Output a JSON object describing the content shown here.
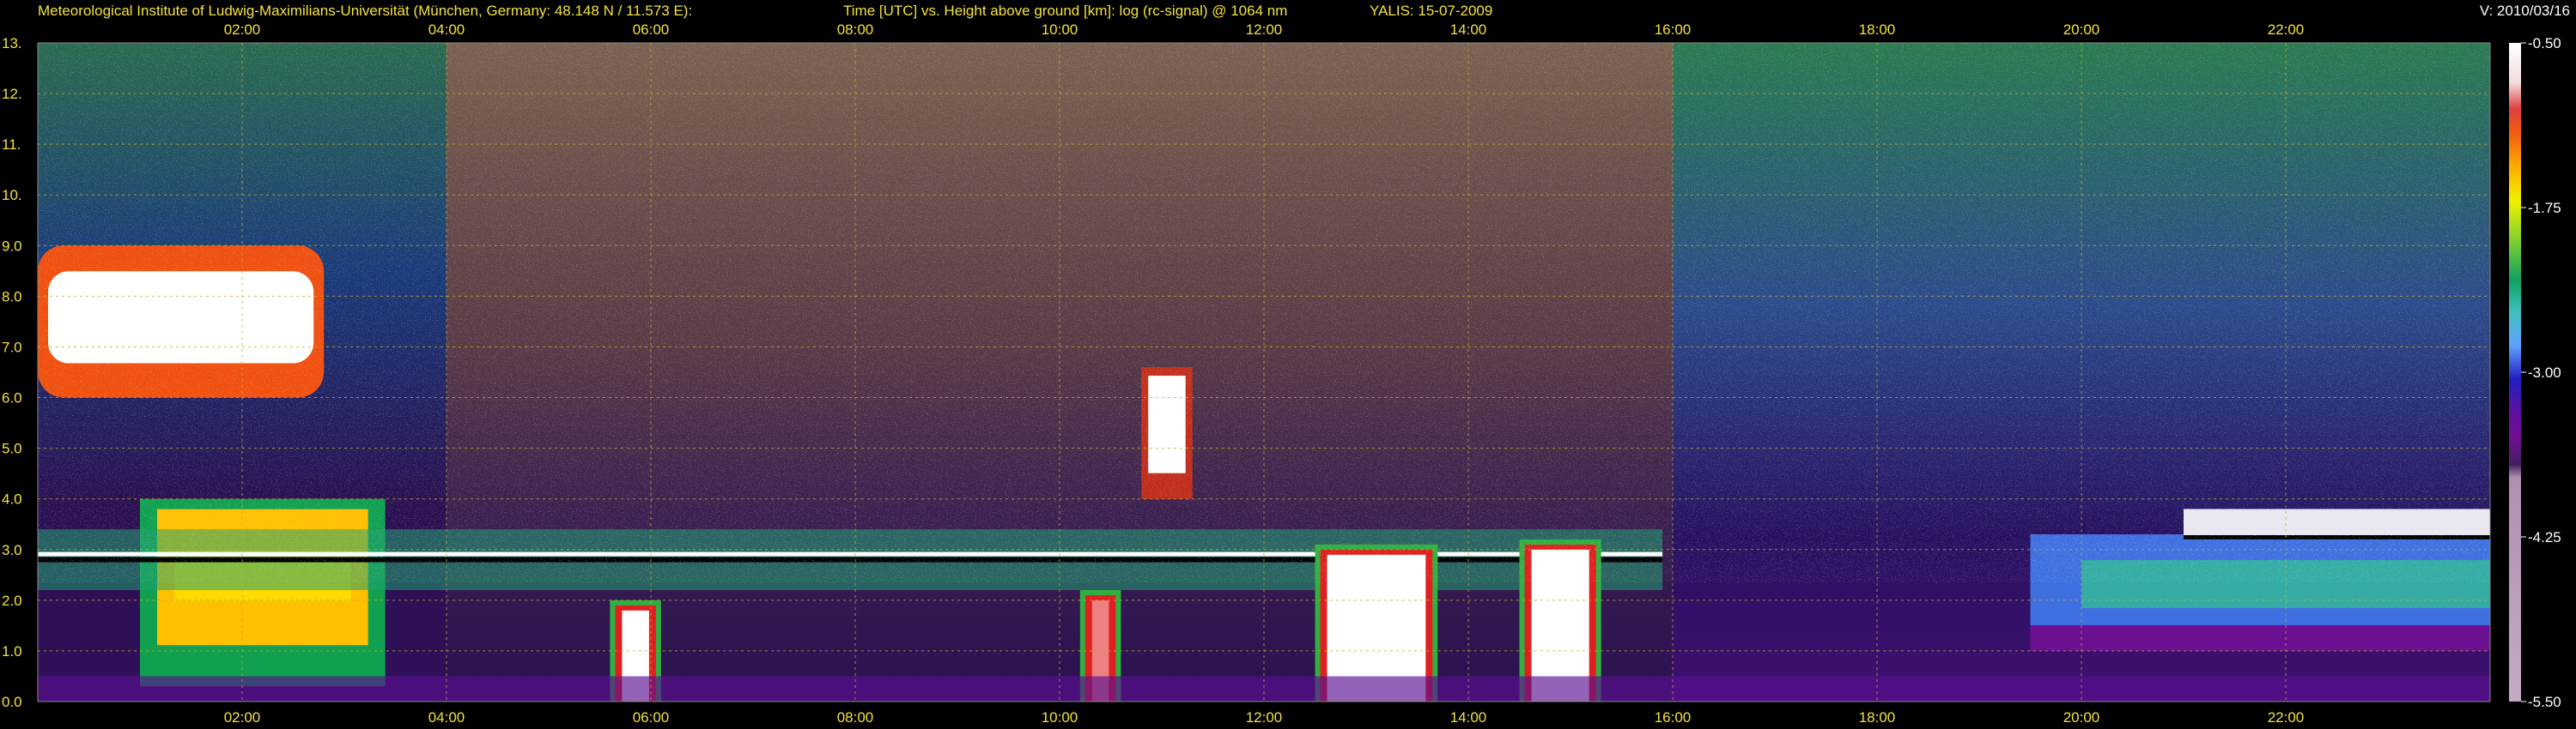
{
  "header": {
    "institute": "Meteorological Institute of Ludwig-Maximilians-Universität (München, Germany: 48.148 N / 11.573 E):",
    "description": "Time [UTC] vs. Height above ground [km]: log (rc-signal) @ 1064 nm",
    "instrument_date": "YALIS: 15-07-2009",
    "version": "V: 2010/03/16"
  },
  "colors": {
    "background": "#000000",
    "header_text": "#f4e23a",
    "tick_text": "#f4e23a",
    "gridline": "#bfae2a"
  },
  "chart_data": {
    "type": "heatmap",
    "title": "Time [UTC] vs. Height above ground [km]: log (rc-signal) @ 1064 nm",
    "x_unit": "hours UTC",
    "xlim": [
      0,
      24
    ],
    "x_ticks": [
      2,
      4,
      6,
      8,
      10,
      12,
      14,
      16,
      18,
      20,
      22
    ],
    "x_tick_labels": [
      "02:00",
      "04:00",
      "06:00",
      "08:00",
      "10:00",
      "12:00",
      "14:00",
      "16:00",
      "18:00",
      "20:00",
      "22:00"
    ],
    "ylim": [
      0,
      13
    ],
    "y_ticks": [
      0,
      1,
      2,
      3,
      4,
      5,
      6,
      7,
      8,
      9,
      10,
      11,
      12,
      13
    ],
    "y_tick_labels": [
      "0.0",
      "1.0",
      "2.0",
      "3.0",
      "4.0",
      "5.0",
      "6.0",
      "7.0",
      "8.0",
      "9.0",
      "10.",
      "11.",
      "12.",
      "13."
    ],
    "grid": true,
    "colorbar": {
      "range": [
        -5.5,
        -0.5
      ],
      "ticks": [
        -0.5,
        -1.75,
        -3.0,
        -4.25,
        -5.5
      ],
      "tick_labels": [
        "-0.50",
        "-1.75",
        "-3.00",
        "-4.25",
        "-5.50"
      ],
      "colors_top_to_bottom": [
        "#ffffff",
        "#f2dede",
        "#ee8080",
        "#e02020",
        "#f06010",
        "#ff9a00",
        "#ffd000",
        "#f4f000",
        "#a0e030",
        "#30c030",
        "#10a060",
        "#30c0c0",
        "#60a0ff",
        "#3060ff",
        "#2020c0",
        "#5010a0",
        "#701090",
        "#502070",
        "#b090b0",
        "#c0a8c0"
      ]
    },
    "features": [
      {
        "kind": "cirrus",
        "start": 0.0,
        "end": 2.8,
        "base": 6.0,
        "top": 9.0,
        "value": -0.5
      },
      {
        "kind": "boundary-layer",
        "start": 1.0,
        "end": 3.4,
        "base": 0.3,
        "top": 4.0,
        "value": -1.5
      },
      {
        "kind": "boundary-layer-top",
        "start": 0.0,
        "end": 15.9,
        "base": 2.2,
        "top": 3.4,
        "value": -0.5
      },
      {
        "kind": "rain-shaft",
        "start": 5.6,
        "end": 6.1,
        "base": 0.0,
        "top": 2.0,
        "value": -0.5
      },
      {
        "kind": "rain-shaft",
        "start": 10.2,
        "end": 10.6,
        "base": 0.0,
        "top": 2.2,
        "value": -1.0
      },
      {
        "kind": "rain-shaft",
        "start": 12.5,
        "end": 13.7,
        "base": 0.0,
        "top": 3.1,
        "value": -0.5
      },
      {
        "kind": "rain-shaft",
        "start": 14.5,
        "end": 15.3,
        "base": 0.0,
        "top": 3.2,
        "value": -0.5
      },
      {
        "kind": "virga",
        "start": 10.8,
        "end": 11.3,
        "base": 4.0,
        "top": 6.6,
        "value": -0.8
      },
      {
        "kind": "aerosol-layer",
        "start": 19.5,
        "end": 24.0,
        "base": 1.0,
        "top": 3.3,
        "value": -2.2
      },
      {
        "kind": "cloud-top",
        "start": 21.0,
        "end": 24.0,
        "base": 3.2,
        "top": 3.8,
        "value": -0.5
      }
    ]
  }
}
